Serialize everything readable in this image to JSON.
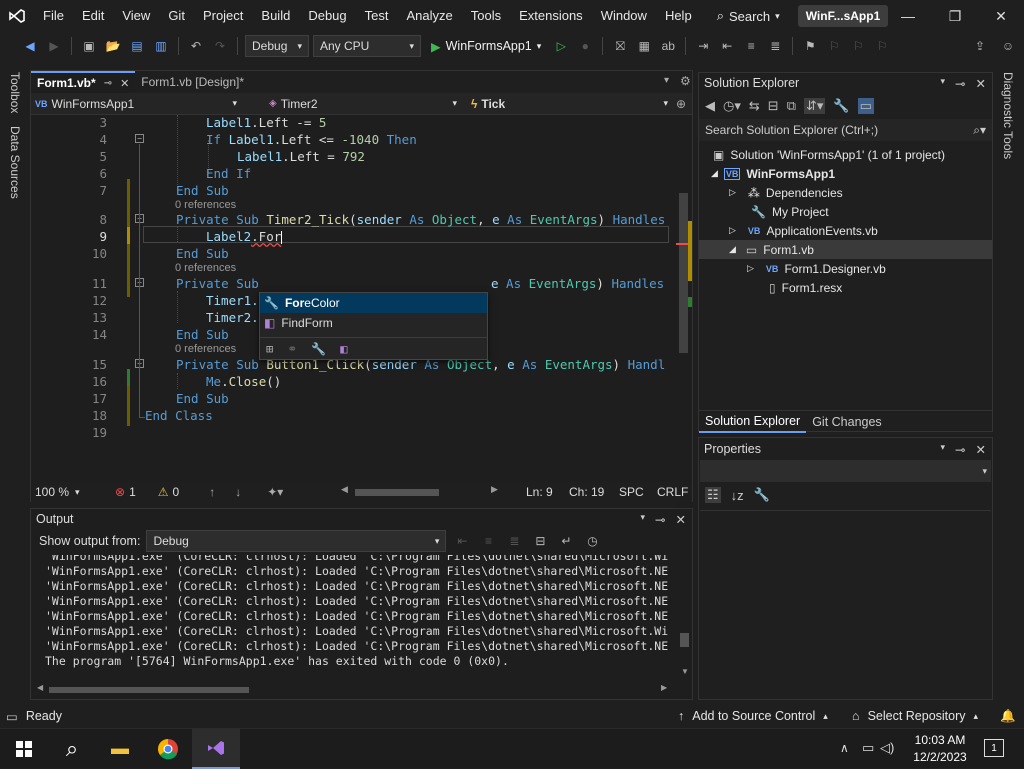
{
  "menu": {
    "items": [
      "File",
      "Edit",
      "View",
      "Git",
      "Project",
      "Build",
      "Debug",
      "Test",
      "Analyze",
      "Tools",
      "Extensions",
      "Window",
      "Help"
    ],
    "search_label": "Search",
    "solution_pill": "WinF...sApp1"
  },
  "toolbar": {
    "config": "Debug",
    "platform": "Any CPU",
    "start_label": "WinFormsApp1"
  },
  "left_strip": {
    "toolbox": "Toolbox",
    "data_sources": "Data Sources"
  },
  "right_strip": {
    "diagnostic": "Diagnostic Tools"
  },
  "editor": {
    "tabs": [
      {
        "label": "Form1.vb*",
        "active": true
      },
      {
        "label": "Form1.vb [Design]*",
        "active": false
      }
    ],
    "nav": {
      "project": "WinFormsApp1",
      "object": "Timer2",
      "event": "Tick"
    },
    "line_numbers": [
      "3",
      "4",
      "5",
      "6",
      "7",
      "8",
      "9",
      "10",
      "11",
      "12",
      "13",
      "14",
      "15",
      "16",
      "17",
      "18",
      "19"
    ],
    "refs": [
      "0 references",
      "0 references",
      "0 references"
    ],
    "code": {
      "l3": [
        "Label1",
        ".Left -= ",
        "5"
      ],
      "l4": [
        "If ",
        "Label1",
        ".Left <= ",
        "-1040",
        " Then"
      ],
      "l5": [
        "Label1",
        ".Left = ",
        "792"
      ],
      "l6": [
        "End If"
      ],
      "l7": [
        "End Sub"
      ],
      "l8": [
        "Private Sub ",
        "Timer2_Tick",
        "(",
        "sender",
        " As ",
        "Object",
        ", ",
        "e",
        " As ",
        "EventArgs",
        ") ",
        "Handles"
      ],
      "l9": [
        "Label2",
        ".For"
      ],
      "l10": [
        "End Sub"
      ],
      "l11": [
        "Private Sub ",
        "e",
        " As ",
        "EventArgs",
        ") ",
        "Handles"
      ],
      "l12": [
        "Timer1."
      ],
      "l13": [
        "Timer2.Start()"
      ],
      "l14": [
        "End Sub"
      ],
      "l15": [
        "Private Sub ",
        "Button1_Click",
        "(",
        "sender",
        " As ",
        "Object",
        ", ",
        "e",
        " As ",
        "EventArgs",
        ") ",
        "Handl"
      ],
      "l16": [
        "Me",
        ".",
        "Close",
        "()"
      ],
      "l17": [
        "End Sub"
      ],
      "l18": [
        "End Class"
      ]
    },
    "autocomplete": {
      "items": [
        {
          "match": "For",
          "rest": "eColor",
          "icon": "wrench-icon",
          "selected": true
        },
        {
          "match": "",
          "rest": "FindForm",
          "icon": "cube-icon",
          "selected": false
        }
      ]
    },
    "status": {
      "zoom": "100 %",
      "errors": "1",
      "warnings": "0",
      "line": "Ln: 9",
      "col": "Ch: 19",
      "spc": "SPC",
      "eol": "CRLF"
    }
  },
  "output": {
    "title": "Output",
    "show_from_label": "Show output from:",
    "source": "Debug",
    "lines": [
      "'WinFormsApp1.exe' (CoreCLR: clrhost): Loaded 'C:\\Program Files\\dotnet\\shared\\Microsoft.Wi",
      "'WinFormsApp1.exe' (CoreCLR: clrhost): Loaded 'C:\\Program Files\\dotnet\\shared\\Microsoft.NE",
      "'WinFormsApp1.exe' (CoreCLR: clrhost): Loaded 'C:\\Program Files\\dotnet\\shared\\Microsoft.NE",
      "'WinFormsApp1.exe' (CoreCLR: clrhost): Loaded 'C:\\Program Files\\dotnet\\shared\\Microsoft.NE",
      "'WinFormsApp1.exe' (CoreCLR: clrhost): Loaded 'C:\\Program Files\\dotnet\\shared\\Microsoft.NE",
      "'WinFormsApp1.exe' (CoreCLR: clrhost): Loaded 'C:\\Program Files\\dotnet\\shared\\Microsoft.Wi",
      "'WinFormsApp1.exe' (CoreCLR: clrhost): Loaded 'C:\\Program Files\\dotnet\\shared\\Microsoft.NE",
      "The program '[5764] WinFormsApp1.exe' has exited with code 0 (0x0)."
    ]
  },
  "solution_explorer": {
    "title": "Solution Explorer",
    "search_placeholder": "Search Solution Explorer (Ctrl+;)",
    "tree": {
      "solution": "Solution 'WinFormsApp1' (1 of 1 project)",
      "project": "WinFormsApp1",
      "dependencies": "Dependencies",
      "my_project": "My Project",
      "app_events": "ApplicationEvents.vb",
      "form1": "Form1.vb",
      "designer": "Form1.Designer.vb",
      "resx": "Form1.resx"
    },
    "tabs": [
      "Solution Explorer",
      "Git Changes"
    ]
  },
  "properties": {
    "title": "Properties"
  },
  "statusbar": {
    "ready": "Ready",
    "source_control": "Add to Source Control",
    "select_repo": "Select Repository"
  },
  "taskbar": {
    "time": "10:03 AM",
    "date": "12/2/2023",
    "notif_count": "1"
  },
  "colors": {
    "accent": "#6a9ef5",
    "keyword": "#569cd6",
    "type": "#4ec9b0",
    "function": "#dcdcaa",
    "error": "#f14c4c"
  }
}
